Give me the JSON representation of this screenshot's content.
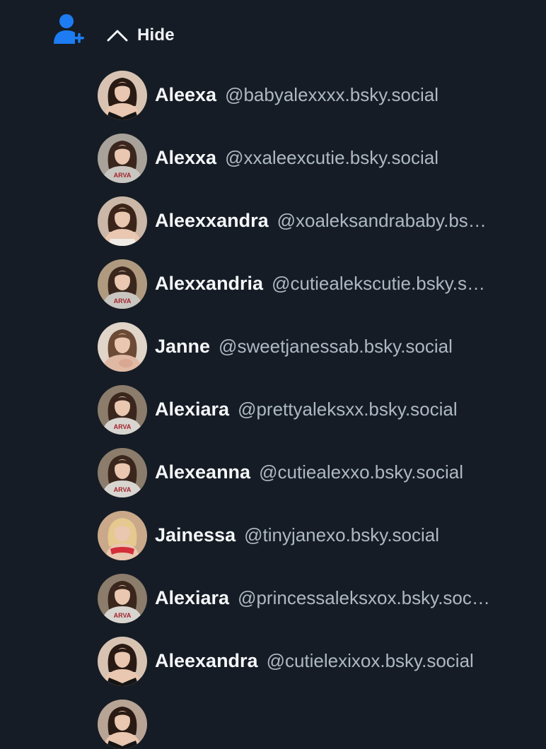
{
  "header": {
    "follow_icon": "person-add-icon",
    "hide_icon": "chevron-up-icon",
    "hide_label": "Hide",
    "accent": "#1d7cf2"
  },
  "accounts": [
    {
      "name": "Aleexa",
      "handle": "@babyalexxxx.bsky.social",
      "avatar_style": "dark-top",
      "avatar_bg": "#d8c3b3",
      "hair": "#2a1a14",
      "top": "#151515"
    },
    {
      "name": "Alexxa",
      "handle": "@xxaleexcutie.bsky.social",
      "avatar_style": "harvard-sweater",
      "avatar_bg": "#a8a29a",
      "hair": "#3a261c",
      "top": "#c9c6c1"
    },
    {
      "name": "Aleexxandra",
      "handle": "@xoaleksandrababy.bs…",
      "avatar_style": "light-top",
      "avatar_bg": "#cbb7a7",
      "hair": "#3b2419",
      "top": "#f0ebe6"
    },
    {
      "name": "Alexxandria",
      "handle": "@cutiealekscutie.bsky.s…",
      "avatar_style": "harvard-sweater",
      "avatar_bg": "#b09a7f",
      "hair": "#3a261c",
      "top": "#c9c6c1"
    },
    {
      "name": "Janne",
      "handle": "@sweetjanessab.bsky.social",
      "avatar_style": "skin",
      "avatar_bg": "#e1d4c8",
      "hair": "#6b4a36",
      "top": "#e0b9a4"
    },
    {
      "name": "Alexiara",
      "handle": "@prettyaleksxx.bsky.social",
      "avatar_style": "harvard-sweater",
      "avatar_bg": "#8c7c6b",
      "hair": "#3a261c",
      "top": "#d8d5d0"
    },
    {
      "name": "Alexeanna",
      "handle": "@cutiealexxo.bsky.social",
      "avatar_style": "harvard-sweater",
      "avatar_bg": "#8c7c6b",
      "hair": "#3a261c",
      "top": "#d8d5d0"
    },
    {
      "name": "Jainessa",
      "handle": "@tinyjanexo.bsky.social",
      "avatar_style": "red-top",
      "avatar_bg": "#c9a98a",
      "hair": "#e6c98f",
      "top": "#d32f3a"
    },
    {
      "name": "Alexiara",
      "handle": "@princessaleksxox.bsky.soc…",
      "avatar_style": "harvard-sweater",
      "avatar_bg": "#8c7c6b",
      "hair": "#3a261c",
      "top": "#d8d5d0"
    },
    {
      "name": "Aleexandra",
      "handle": "@cutielexixox.bsky.social",
      "avatar_style": "dark-top",
      "avatar_bg": "#d8c3b3",
      "hair": "#2a1a14",
      "top": "#151515"
    }
  ],
  "partial_avatar": {
    "avatar_bg": "#b8a495",
    "hair": "#2a1a14"
  }
}
